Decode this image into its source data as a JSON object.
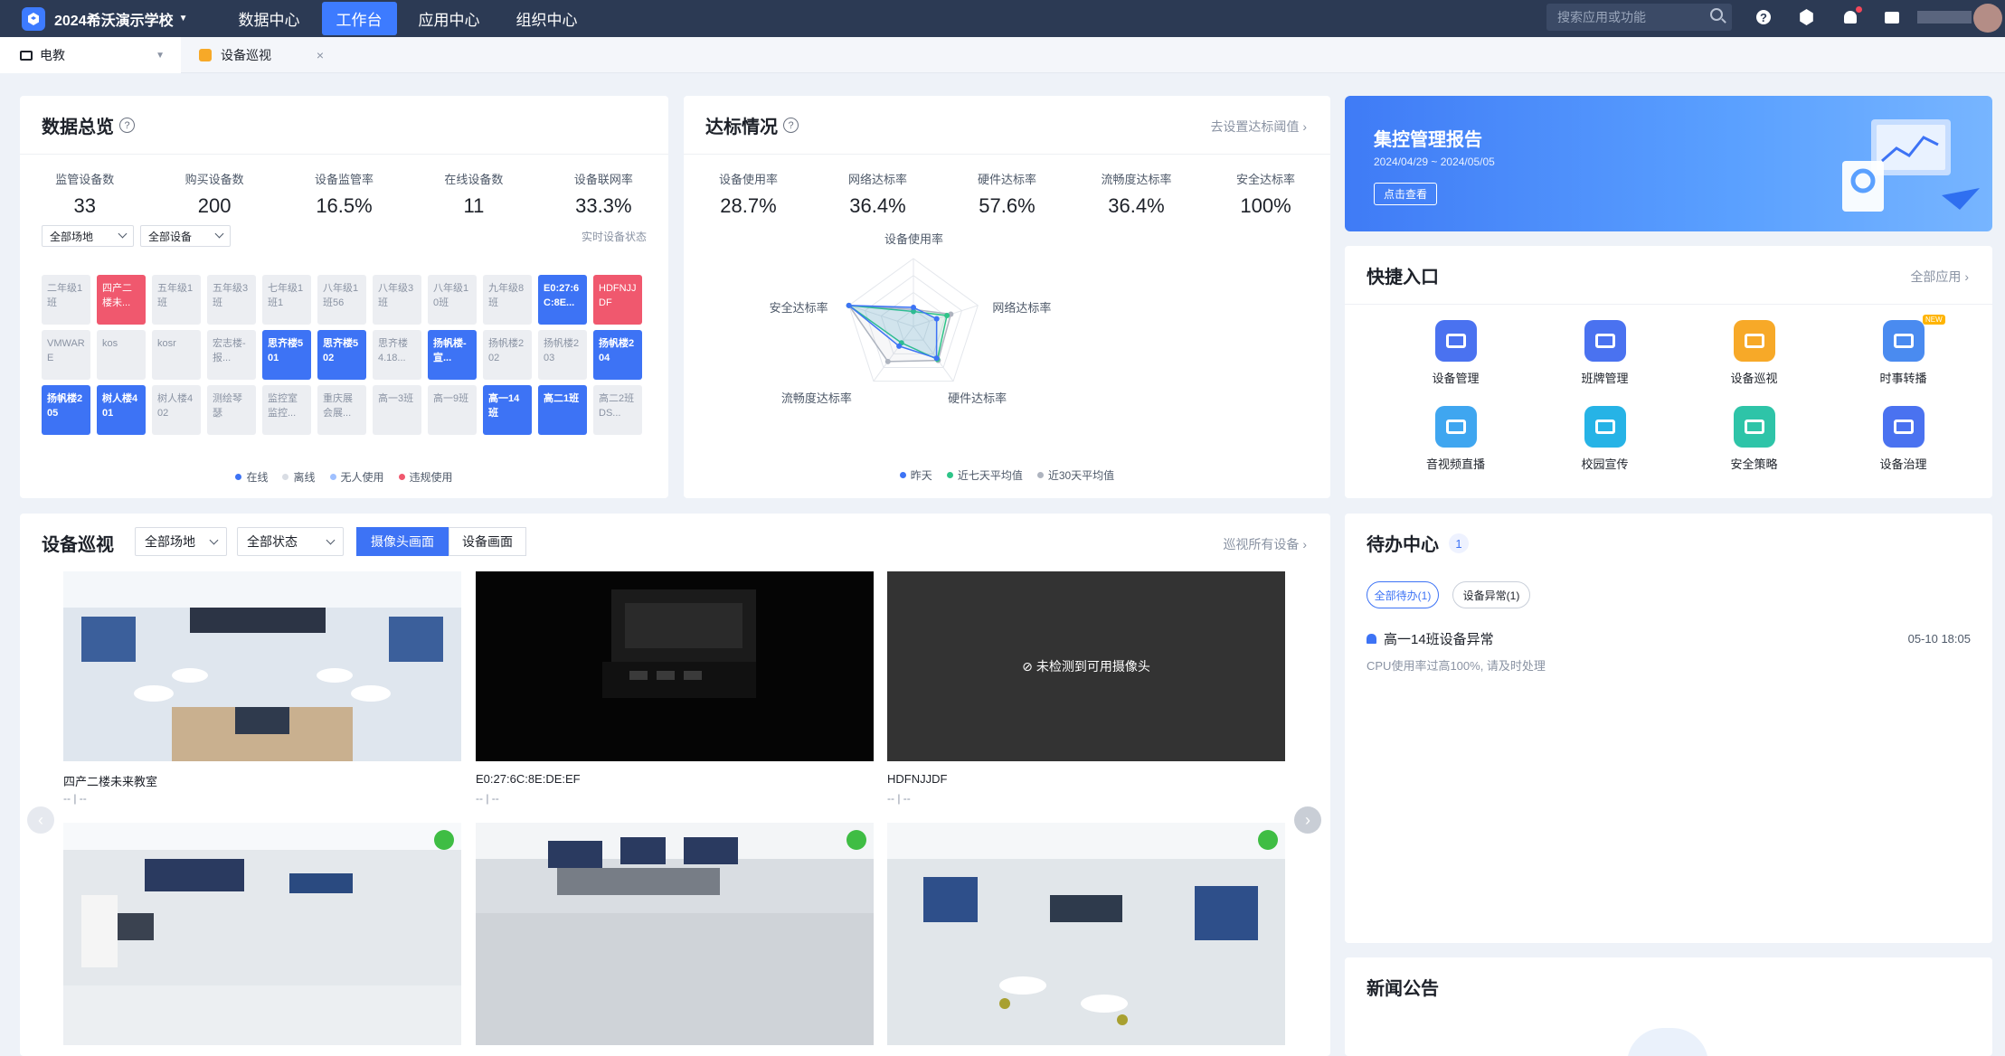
{
  "topbar": {
    "school": "2024希沃演示学校",
    "nav": [
      "数据中心",
      "工作台",
      "应用中心",
      "组织中心"
    ],
    "active_nav": "工作台",
    "search_placeholder": "搜索应用或功能"
  },
  "tabs": [
    {
      "label": "电教",
      "icon": "monitor-icon"
    },
    {
      "label": "设备巡视",
      "icon": "patrol-icon"
    }
  ],
  "overview": {
    "title": "数据总览",
    "stats": [
      {
        "label": "监管设备数",
        "value": "33"
      },
      {
        "label": "购买设备数",
        "value": "200"
      },
      {
        "label": "设备监管率",
        "value": "16.5%"
      },
      {
        "label": "在线设备数",
        "value": "11"
      },
      {
        "label": "设备联网率",
        "value": "33.3%"
      }
    ],
    "filter_site": "全部场地",
    "filter_device": "全部设备",
    "realtime_label": "实时设备状态",
    "devices": [
      {
        "name": "二年级1班",
        "status": "offline"
      },
      {
        "name": "四产二楼未...",
        "status": "violation"
      },
      {
        "name": "五年级1班",
        "status": "offline"
      },
      {
        "name": "五年级3班",
        "status": "offline"
      },
      {
        "name": "七年级1班1",
        "status": "offline"
      },
      {
        "name": "八年级1班56",
        "status": "offline"
      },
      {
        "name": "八年级3班",
        "status": "offline"
      },
      {
        "name": "八年级10班",
        "status": "offline"
      },
      {
        "name": "九年级8班",
        "status": "offline"
      },
      {
        "name": "E0:27:6C:8E...",
        "status": "online"
      },
      {
        "name": "HDFNJJDF",
        "status": "violation"
      },
      {
        "name": "VMWARE",
        "status": "offline"
      },
      {
        "name": "kos",
        "status": "offline"
      },
      {
        "name": "kosr",
        "status": "offline"
      },
      {
        "name": "宏志楼-报...",
        "status": "offline"
      },
      {
        "name": "思齐楼501",
        "status": "online"
      },
      {
        "name": "思齐楼502",
        "status": "online"
      },
      {
        "name": "思齐楼4.18...",
        "status": "offline"
      },
      {
        "name": "扬帆楼-宣...",
        "status": "online"
      },
      {
        "name": "扬帆楼202",
        "status": "offline"
      },
      {
        "name": "扬帆楼203",
        "status": "offline"
      },
      {
        "name": "扬帆楼204",
        "status": "online"
      },
      {
        "name": "扬帆楼205",
        "status": "online"
      },
      {
        "name": "树人楼401",
        "status": "online"
      },
      {
        "name": "树人楼402",
        "status": "offline"
      },
      {
        "name": "测绘琴瑟",
        "status": "offline"
      },
      {
        "name": "监控室监控...",
        "status": "offline"
      },
      {
        "name": "重庆展会展...",
        "status": "offline"
      },
      {
        "name": "高一3班",
        "status": "offline"
      },
      {
        "name": "高一9班",
        "status": "offline"
      },
      {
        "name": "高一14班",
        "status": "online"
      },
      {
        "name": "高二1班",
        "status": "online"
      },
      {
        "name": "高二2班DS...",
        "status": "offline"
      }
    ],
    "legend": [
      {
        "label": "在线",
        "color": "#3d73f5"
      },
      {
        "label": "离线",
        "color": "#d9dde4"
      },
      {
        "label": "无人使用",
        "color": "#9fc0ff"
      },
      {
        "label": "违规使用",
        "color": "#f0586e"
      }
    ]
  },
  "compliance": {
    "title": "达标情况",
    "link": "去设置达标阈值",
    "stats": [
      {
        "label": "设备使用率",
        "value": "28.7%"
      },
      {
        "label": "网络达标率",
        "value": "36.4%"
      },
      {
        "label": "硬件达标率",
        "value": "57.6%"
      },
      {
        "label": "流畅度达标率",
        "value": "36.4%"
      },
      {
        "label": "安全达标率",
        "value": "100%"
      }
    ],
    "radar_axes": [
      "设备使用率",
      "网络达标率",
      "硬件达标率",
      "流畅度达标率",
      "安全达标率"
    ],
    "radar_series": [
      {
        "name": "昨天",
        "color": "#3d73f5",
        "values": [
          0.28,
          0.36,
          0.58,
          0.36,
          1.0
        ]
      },
      {
        "name": "近七天平均值",
        "color": "#2ec488",
        "values": [
          0.22,
          0.52,
          0.6,
          0.3,
          1.0
        ]
      },
      {
        "name": "近30天平均值",
        "color": "#aeb4bf",
        "values": [
          0.25,
          0.58,
          0.62,
          0.64,
          1.0
        ]
      }
    ]
  },
  "banner": {
    "title": "集控管理报告",
    "date_range": "2024/04/29 ~ 2024/05/05",
    "button": "点击查看"
  },
  "quick": {
    "title": "快捷入口",
    "link": "全部应用",
    "items": [
      {
        "label": "设备管理",
        "color": "#4a72f0",
        "icon": "device-manage-icon"
      },
      {
        "label": "班牌管理",
        "color": "#4a72f0",
        "icon": "class-sign-icon"
      },
      {
        "label": "设备巡视",
        "color": "#f7a928",
        "icon": "device-patrol-icon"
      },
      {
        "label": "时事转播",
        "color": "#4a8bf0",
        "icon": "news-relay-icon",
        "badge": "NEW"
      },
      {
        "label": "音视频直播",
        "color": "#3fa6f0",
        "icon": "av-live-icon"
      },
      {
        "label": "校园宣传",
        "color": "#26b3e6",
        "icon": "campus-promo-icon"
      },
      {
        "label": "安全策略",
        "color": "#2ec4a8",
        "icon": "security-policy-icon"
      },
      {
        "label": "设备治理",
        "color": "#4a72f0",
        "icon": "device-govern-icon"
      }
    ]
  },
  "patrol": {
    "title": "设备巡视",
    "filter_site": "全部场地",
    "filter_status": "全部状态",
    "seg_camera": "摄像头画面",
    "seg_screen": "设备画面",
    "link": "巡视所有设备",
    "cameras": [
      {
        "name": "四产二楼未来教室",
        "sub": "-- | --",
        "kind": "room"
      },
      {
        "name": "E0:27:6C:8E:DE:EF",
        "sub": "-- | --",
        "kind": "dark"
      },
      {
        "name": "HDFNJJDF",
        "sub": "-- | --",
        "kind": "none",
        "message": "未检测到可用摄像头"
      },
      {
        "name": "",
        "sub": "",
        "kind": "room2"
      },
      {
        "name": "",
        "sub": "",
        "kind": "room3"
      },
      {
        "name": "",
        "sub": "",
        "kind": "room4"
      }
    ]
  },
  "todo": {
    "title": "待办中心",
    "count": "1",
    "chips": [
      "全部待办(1)",
      "设备异常(1)"
    ],
    "items": [
      {
        "title": "高一14班设备异常",
        "time": "05-10 18:05",
        "desc": "CPU使用率过高100%, 请及时处理"
      }
    ]
  },
  "news": {
    "title": "新闻公告"
  }
}
